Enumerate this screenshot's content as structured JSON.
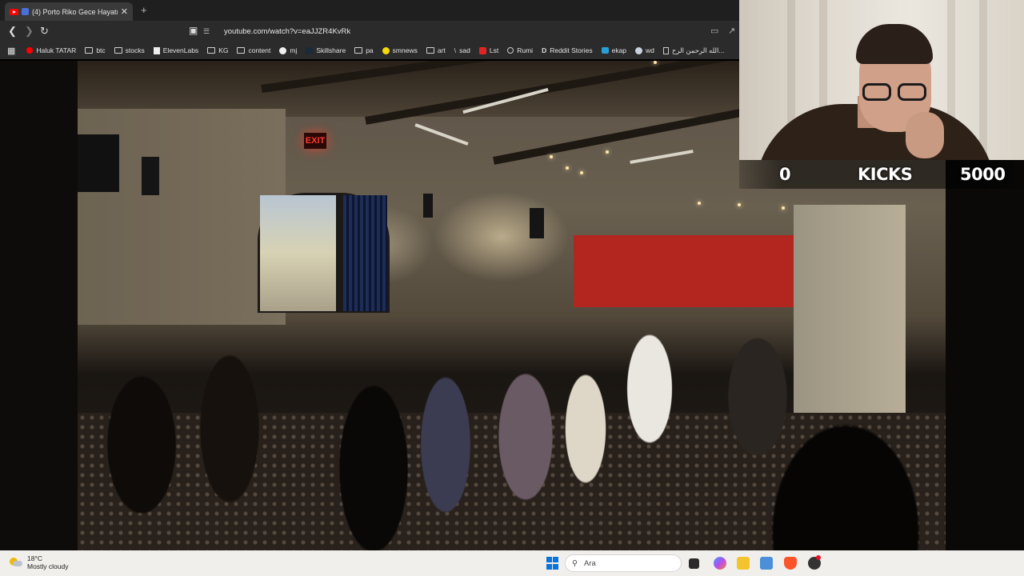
{
  "browser": {
    "tab_title": "(4) Porto Riko Gece Hayatı: G",
    "tab_close": "✕",
    "new_tab": "+",
    "url": "youtube.com/watch?v=eaJJZR4KvRk",
    "bookmarks": [
      {
        "label": "Haluk TATAR",
        "icon": "youtube-icon"
      },
      {
        "label": "btc",
        "icon": "folder-icon"
      },
      {
        "label": "stocks",
        "icon": "folder-icon"
      },
      {
        "label": "ElevenLabs",
        "icon": "elevenlabs-icon"
      },
      {
        "label": "KG",
        "icon": "folder-icon"
      },
      {
        "label": "content",
        "icon": "folder-icon"
      },
      {
        "label": "mj",
        "icon": "github-icon"
      },
      {
        "label": "Skillshare",
        "icon": "skillshare-icon"
      },
      {
        "label": "pa",
        "icon": "folder-icon"
      },
      {
        "label": "smnews",
        "icon": "smiley-icon"
      },
      {
        "label": "art",
        "icon": "folder-icon"
      },
      {
        "label": "sad",
        "icon": "slash-icon"
      },
      {
        "label": "Lst",
        "icon": "s-icon"
      },
      {
        "label": "Rumi",
        "icon": "globe-icon"
      },
      {
        "label": "Reddit Stories",
        "icon": "d-icon"
      },
      {
        "label": "ekap",
        "icon": "bird-icon"
      },
      {
        "label": "wd",
        "icon": "wd-icon"
      },
      {
        "label": "الله الرحمن الرح...",
        "icon": "page-icon"
      }
    ]
  },
  "overlay": {
    "kicks_count": "0",
    "kicks_label": "KICKS",
    "kicks_goal": "5000"
  },
  "video_scene": {
    "exit_sign": "EXIT"
  },
  "taskbar": {
    "temperature": "18°C",
    "condition": "Mostly cloudy",
    "search_placeholder": "Ara"
  },
  "colors": {
    "tabbar_bg": "#1f1f1f",
    "toolbar_bg": "#2b2b2b",
    "taskbar_bg": "#f1efec",
    "youtube_red": "#ff0000",
    "windows_blue": "#0a74da"
  }
}
